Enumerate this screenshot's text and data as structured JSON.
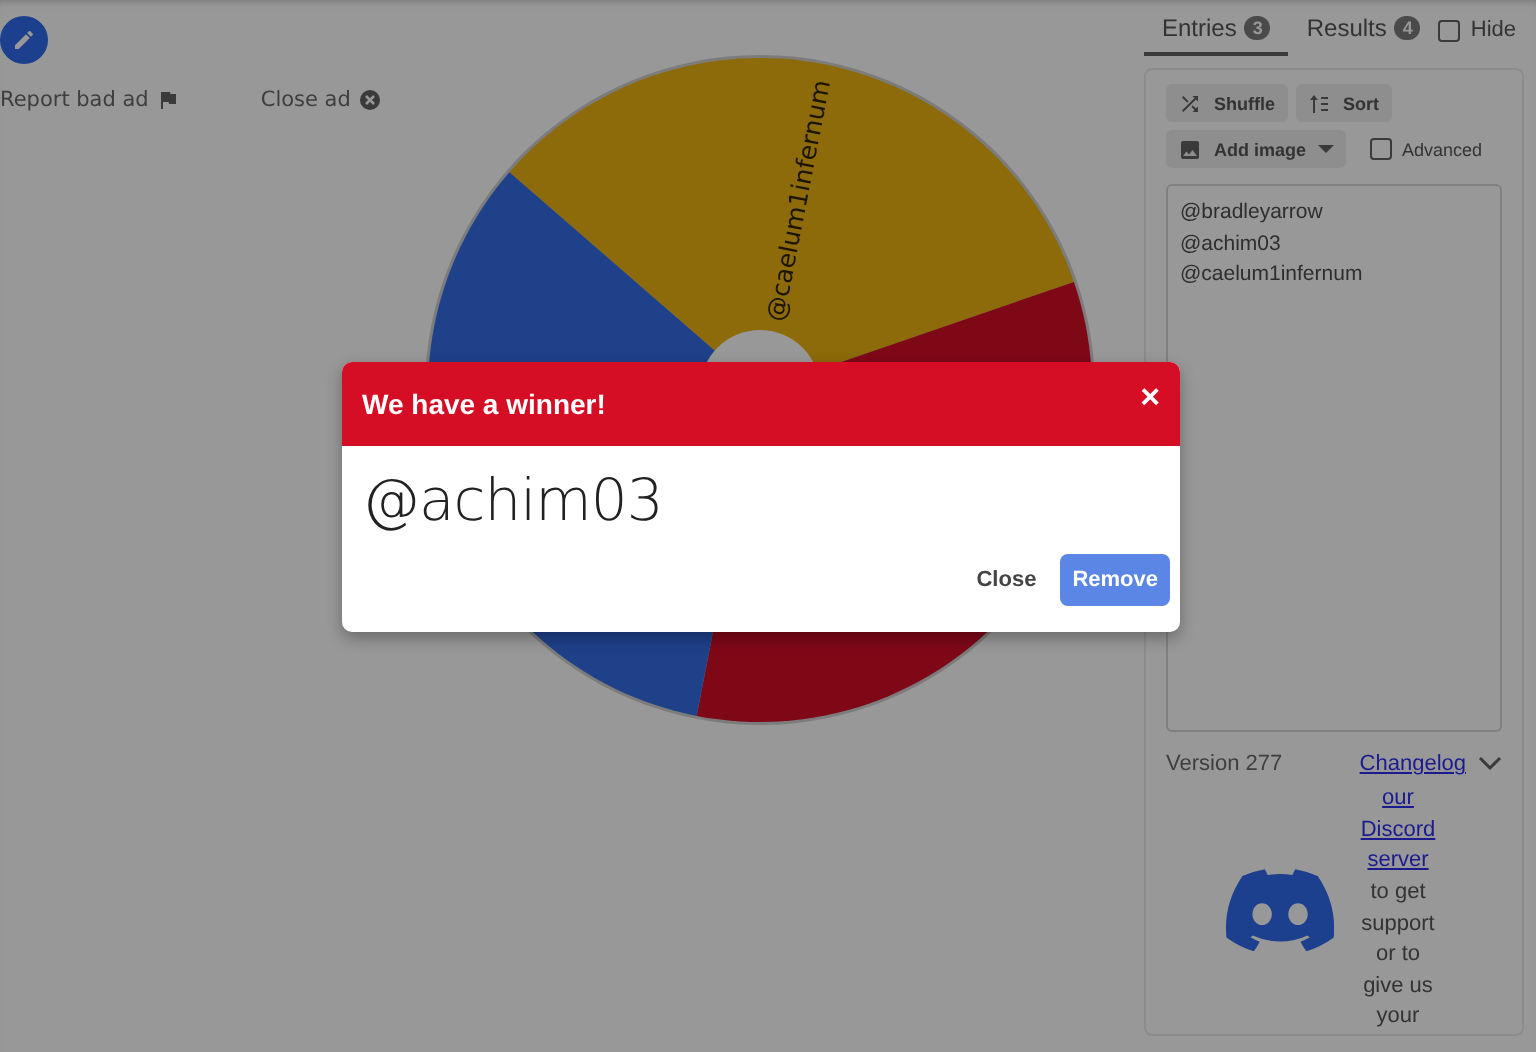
{
  "ad_bar": {
    "report": "Report bad ad",
    "close": "Close ad"
  },
  "wheel": {
    "segments": [
      {
        "color": "#8d6b0a",
        "label": "@caelum1infernum"
      },
      {
        "color": "#7f0817"
      },
      {
        "color": "#1f418a"
      }
    ]
  },
  "dialog": {
    "title": "We have a winner!",
    "close_glyph": "×",
    "winner": "@achim03",
    "buttons": [
      "Close",
      "Remove"
    ]
  },
  "tabs": [
    {
      "label": "Entries",
      "count": "3",
      "selected": true
    },
    {
      "label": "Results",
      "count": "4",
      "selected": false
    }
  ],
  "hide": {
    "label": "Hide",
    "checked": false
  },
  "tools": {
    "shuffle": "Shuffle",
    "sort": "Sort",
    "add_image": "Add image",
    "advanced": {
      "label": "Advanced",
      "checked": false
    }
  },
  "entries": [
    "@bradleyarrow",
    "@achim03",
    "@caelum1infernum"
  ],
  "version": "Version 277",
  "changelog": "Changelog",
  "discord": {
    "link_lines": [
      "our",
      "Discord",
      "server"
    ],
    "text_lines": [
      "to get",
      "support",
      "or to",
      "give us",
      "your"
    ]
  }
}
